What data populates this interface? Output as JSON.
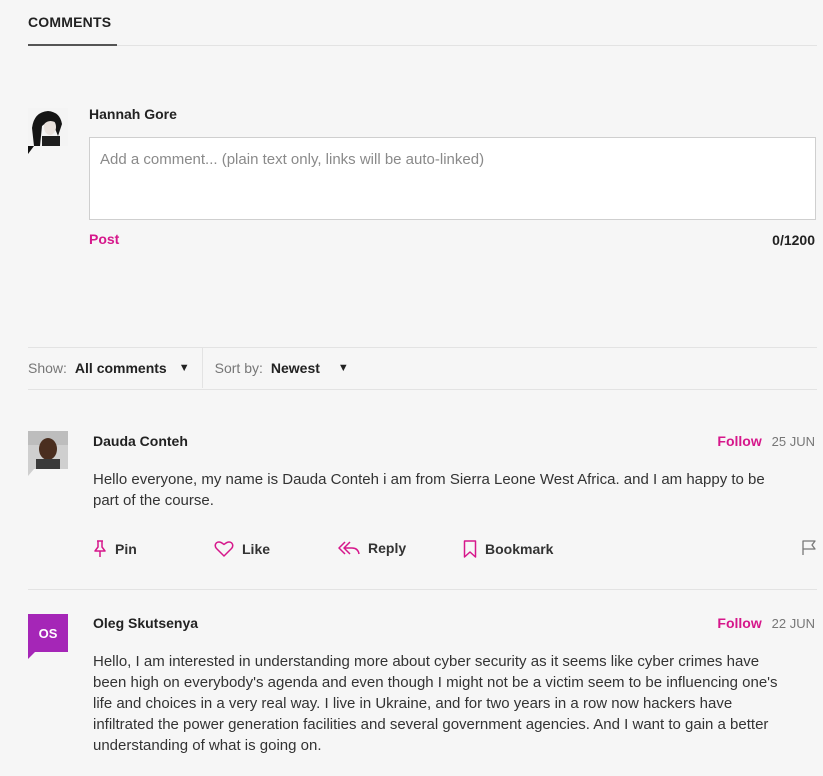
{
  "header": {
    "tab_label": "COMMENTS"
  },
  "composer": {
    "user_name": "Hannah Gore",
    "placeholder": "Add a comment... (plain text only, links will be auto-linked)",
    "value": "",
    "post_label": "Post",
    "char_count": "0/1200"
  },
  "filters": {
    "show_label": "Show:",
    "show_value": "All comments",
    "sort_label": "Sort by:",
    "sort_value": "Newest"
  },
  "comments": [
    {
      "author": "Dauda Conteh",
      "follow_label": "Follow",
      "date": "25 JUN",
      "text": "Hello everyone, my name is Dauda Conteh i am from Sierra Leone West Africa. and I am happy to be part of the course.",
      "actions": {
        "pin": "Pin",
        "like": "Like",
        "reply": "Reply",
        "bookmark": "Bookmark"
      }
    },
    {
      "author": "Oleg Skutsenya",
      "initials": "OS",
      "follow_label": "Follow",
      "date": "22 JUN",
      "text": "Hello, I am interested in understanding more about cyber security as it seems like cyber crimes have been high on everybody's agenda and even though I might not be a victim seem to be influencing one's life and choices in a very real way. I live in Ukraine, and for two years in a row now hackers have infiltrated the power generation facilities and several government agencies. And I want to gain a better understanding of what is going on."
    }
  ],
  "colors": {
    "accent": "#d6178b",
    "initials_avatar": "#a526b7",
    "background": "#f6f6f6"
  },
  "icons": [
    "pin-icon",
    "heart-icon",
    "reply-icon",
    "bookmark-icon",
    "flag-icon",
    "dropdown-caret-icon"
  ]
}
